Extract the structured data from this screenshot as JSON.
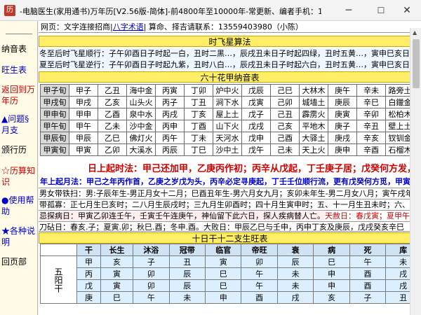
{
  "window": {
    "title": "-电脑医生(家用通书)万年历[V2.56版-简体]-前4800年至10000年-常更新、编者手机：1355..."
  },
  "sidebar": {
    "items": [
      {
        "label": "纳音表",
        "color": "#000000"
      },
      {
        "label": "旺生表",
        "color": "#0000cc"
      },
      {
        "label": "返回到万年历",
        "color": "#cc0000"
      },
      {
        "label": "▲问题§月支",
        "color": "#0000cc"
      },
      {
        "label": "颁行历",
        "color": "#000000"
      },
      {
        "label": "☆历算知识",
        "color": "#cc0000"
      },
      {
        "label": "●使用帮助",
        "color": "#0000cc"
      },
      {
        "label": "★各种说明",
        "color": "#0000cc"
      },
      {
        "label": "回页部",
        "color": "#000000"
      }
    ]
  },
  "webbar": {
    "prefix": "网页：文字连接招商",
    "link": "八字术语",
    "suffix": "算命、择吉请联系：13559403980（小陈）"
  },
  "feixing": {
    "header": "时飞星算法",
    "line1": "冬至后时飞星顺行：子午卯酉日子时起一白，丑时二黑…，辰戌丑未日子时起四绿，丑时五黄…，寅申巳亥日子时起七赤",
    "line2": "夏至后时飞星逆行：子午卯酉日子时起九紫，丑时八白…，辰戌丑未日子时起六白，丑时五黄…，寅申巳亥日子时起三碧"
  },
  "nayin": {
    "header": "六十花甲纳音表",
    "rows": [
      [
        "甲子旬",
        "甲子",
        "乙丑",
        "海中金",
        "丙寅",
        "丁卯",
        "炉中火",
        "戊辰",
        "己巳",
        "大林木",
        "庚午",
        "辛未",
        "路旁土"
      ],
      [
        "甲戌旬",
        "甲戌",
        "乙亥",
        "山头火",
        "丙子",
        "丁丑",
        "涧下水",
        "戊寅",
        "己卯",
        "城墙土",
        "庚辰",
        "辛巳",
        "白鑞金"
      ],
      [
        "甲申旬",
        "甲申",
        "乙酉",
        "泉中水",
        "丙戌",
        "丁亥",
        "屋上土",
        "戊子",
        "己丑",
        "霹雳火",
        "庚寅",
        "辛卯",
        "松柏木"
      ],
      [
        "甲午旬",
        "甲午",
        "乙未",
        "沙中金",
        "丙申",
        "丁酉",
        "山下火",
        "戊戌",
        "己亥",
        "平地木",
        "庚子",
        "辛丑",
        "壁上土"
      ],
      [
        "甲辰旬",
        "甲辰",
        "乙巳",
        "佛灯火",
        "丙午",
        "丁未",
        "天河水",
        "戊申",
        "己酉",
        "大驿土",
        "庚戌",
        "辛亥",
        "钗钏金"
      ],
      [
        "甲寅旬",
        "甲寅",
        "乙卯",
        "大溪水",
        "丙辰",
        "丁巳",
        "沙中土",
        "戊午",
        "己未",
        "天上火",
        "庚申",
        "辛酉",
        "石榴木"
      ]
    ]
  },
  "rishang": "日上起时法：甲己还加甲，乙庚丙作初；丙辛从戊起，丁壬庚子居；戊癸何方发，壬子是真途。",
  "nianshang": "年上起月法：甲己之年丙作首，乙庚之岁戊为头，丙辛必定寻庚起，丁壬壬位顺行流，更有戊癸何方觅，甲寅之上好追求。",
  "nanzhi": "男女带铁扫：男:子辰年生-男正月女十二月；巳酉丑年生-男六月女九月；亥卯未年生-男二月女八月；寅午戌年生",
  "daigu": "带孤寡：正七月生巳亥时；二八月生辰戌时；三九月生卯酉时；四十月生寅申时；五、十一月生丑未时；六、十二月生子午时",
  "jibing": {
    "text": "忌探病日：甲寅乙卯连壬午，壬寅壬午连庚午，神仙留下此六日，探人疾病替人亡。",
    "red": "天赦日：春戊寅；夏甲午"
  },
  "daoren": "刀砧日：春亥.子；夏寅.卯；秋巳.酉；冬申.酉。大败日：甲辰乙巳与壬申，丙申丁亥及庚辰，戊戌癸亥辛巳",
  "wangsheng": {
    "header": "十日干十二支生旺表",
    "columns": [
      "干",
      "长生",
      "沐浴",
      "冠带",
      "临官",
      "帝旺",
      "衰",
      "病",
      "死",
      "库"
    ],
    "group": "五阳干",
    "rows": [
      [
        "甲",
        "亥",
        "子",
        "丑",
        "寅",
        "卯",
        "辰",
        "巳",
        "午",
        "未"
      ],
      [
        "丙",
        "寅",
        "卯",
        "辰",
        "巳",
        "午",
        "未",
        "申",
        "酉",
        "戌"
      ],
      [
        "戊",
        "寅",
        "卯",
        "辰",
        "巳",
        "午",
        "未",
        "申",
        "酉",
        "戌"
      ],
      [
        "庚",
        "巳",
        "午",
        "未",
        "申",
        "酉",
        "戌",
        "亥",
        "子",
        "丑"
      ]
    ]
  }
}
